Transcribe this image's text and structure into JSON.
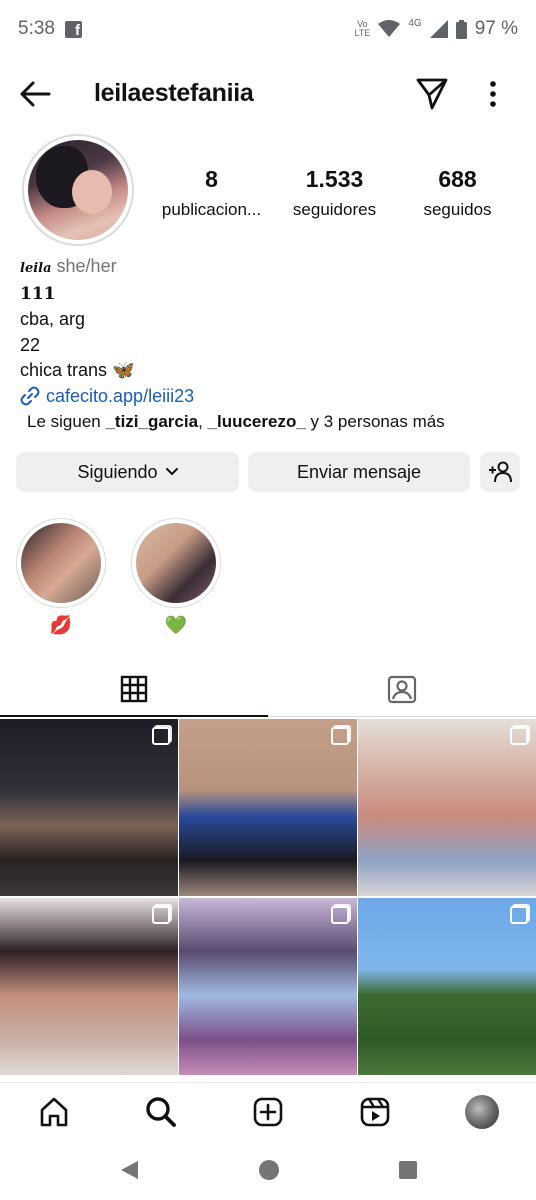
{
  "status_bar": {
    "time": "5:38",
    "app_icon": "f",
    "network_volte_top": "Vo",
    "network_volte_bottom": "LTE",
    "network_type": "4G",
    "battery": "97 %"
  },
  "header": {
    "username": "leilaestefaniia",
    "back_icon": "arrow-left-icon",
    "send_icon": "paper-plane-icon",
    "more_icon": "more-vertical-icon"
  },
  "stats": [
    {
      "value": "8",
      "label": "publicacion..."
    },
    {
      "value": "1.533",
      "label": "seguidores"
    },
    {
      "value": "688",
      "label": "seguidos"
    }
  ],
  "bio": {
    "name": "leila",
    "pronouns": "she/her",
    "line1": "111",
    "line2": "cba, arg",
    "line3": "22",
    "line4": "chica trans 🦋",
    "link": "cafecito.app/leiii23"
  },
  "followed_by": {
    "prefix": "Le siguen ",
    "user1": "_tizi_garcia",
    "sep": ", ",
    "user2": "_luucerezo_",
    "suffix": " y 3 personas más"
  },
  "buttons": {
    "following": "Siguiendo",
    "message": "Enviar mensaje"
  },
  "highlights": [
    {
      "label": "💋"
    },
    {
      "label": "💚"
    }
  ],
  "tabs": {
    "grid_icon": "grid-icon",
    "tagged_icon": "tagged-icon"
  },
  "posts_count": 6,
  "bottom_nav": [
    "home-icon",
    "search-icon",
    "create-icon",
    "reels-icon",
    "profile-avatar"
  ],
  "colors": {
    "link": "#1a5db4",
    "button_bg": "#efefef",
    "secondary_text": "#737373"
  }
}
